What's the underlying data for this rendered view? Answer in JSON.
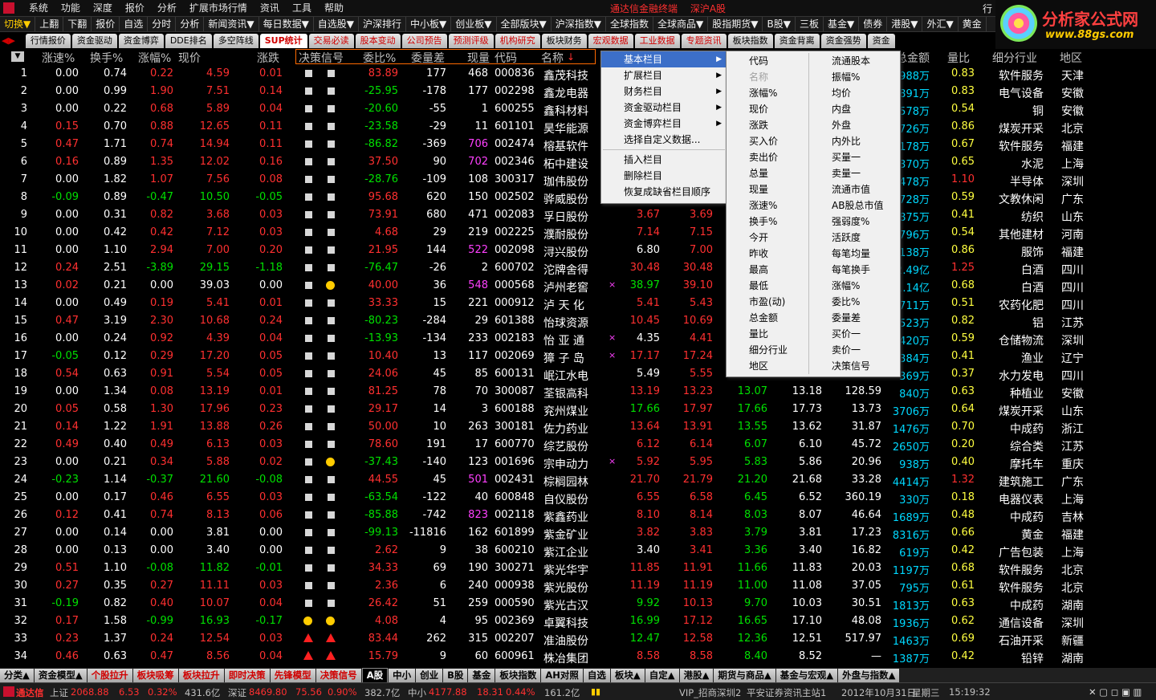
{
  "menubar": {
    "items": [
      "系统",
      "功能",
      "深度",
      "报价",
      "分析",
      "扩展市场行情",
      "资讯",
      "工具",
      "帮助"
    ],
    "center": [
      "通达信金融终端",
      "深沪A股"
    ],
    "right_stub": "行"
  },
  "toolbar": [
    "切换▼",
    "上翻",
    "下翻",
    "报价",
    "自选",
    "分时",
    "分析",
    "新闻资讯▼",
    "每日数据▼",
    "自选股▼",
    "沪深排行",
    "中小板▼",
    "创业板▼",
    "全部版块▼",
    "沪深指数▼",
    "全球指数",
    "全球商品▼",
    "股指期货▼",
    "B股▼",
    "三板",
    "基金▼",
    "债券",
    "港股▼",
    "外汇▼",
    "黄金"
  ],
  "brand": {
    "name": "分析家公式网",
    "url": "www.88gs.com"
  },
  "tabs": [
    {
      "label": "行情报价",
      "style": "normal"
    },
    {
      "label": "资金驱动",
      "style": "normal"
    },
    {
      "label": "资金博弈",
      "style": "normal"
    },
    {
      "label": "DDE排名",
      "style": "normal"
    },
    {
      "label": "多空阵线",
      "style": "normal"
    },
    {
      "label": "SUP统计",
      "style": "active"
    },
    {
      "label": "交易必读",
      "style": "red"
    },
    {
      "label": "股本变动",
      "style": "red"
    },
    {
      "label": "公司预告",
      "style": "red"
    },
    {
      "label": "预测评级",
      "style": "red"
    },
    {
      "label": "机构研究",
      "style": "red"
    },
    {
      "label": "板块财务",
      "style": "normal"
    },
    {
      "label": "宏观数据",
      "style": "red"
    },
    {
      "label": "工业数据",
      "style": "red"
    },
    {
      "label": "专题资讯",
      "style": "red"
    },
    {
      "label": "板块指数",
      "style": "normal"
    },
    {
      "label": "资金背离",
      "style": "normal"
    },
    {
      "label": "资金强势",
      "style": "normal"
    },
    {
      "label": "资金",
      "style": "normal"
    }
  ],
  "columns": [
    "涨速%",
    "换手%",
    "涨幅%",
    "现价",
    "涨跌",
    "决策信号",
    "委比%",
    "委量差",
    "现量",
    "代码",
    "名称",
    "总金额",
    "量比",
    "细分行业",
    "地区"
  ],
  "sort_icon": "▼",
  "rows": [
    {
      "n": "1",
      "spd": "0.00",
      "hs": "0.74",
      "zf": "0.22",
      "xj": "4.59",
      "zd": "0.01",
      "sig": "sq",
      "wb": "83.89",
      "wlc": "177",
      "xl": "468",
      "code": "000836",
      "name": "鑫茂科技",
      "p1": "",
      "p2": "",
      "p3": "",
      "p4": "",
      "p5": "",
      "amt": "988万",
      "lb": "0.83",
      "ind": "软件服务",
      "area": "天津"
    },
    {
      "n": "2",
      "spd": "0.00",
      "hs": "0.99",
      "zf": "1.90",
      "xj": "7.51",
      "zd": "0.14",
      "sig": "sq",
      "wb": "-25.95",
      "wlc": "-178",
      "xl": "177",
      "code": "002298",
      "name": "鑫龙电器",
      "p1": "",
      "p2": "",
      "p3": "",
      "p4": "",
      "p5": "",
      "amt": "891万",
      "lb": "0.83",
      "ind": "电气设备",
      "area": "安徽"
    },
    {
      "n": "3",
      "spd": "0.00",
      "hs": "0.22",
      "zf": "0.68",
      "xj": "5.89",
      "zd": "0.04",
      "sig": "sq",
      "wb": "-20.60",
      "wlc": "-55",
      "xl": "1",
      "code": "600255",
      "name": "鑫科材料",
      "p1": "",
      "p2": "",
      "p3": "",
      "p4": "",
      "p5": "",
      "amt": "578万",
      "lb": "0.54",
      "ind": "铜",
      "area": "安徽"
    },
    {
      "n": "4",
      "spd": "0.15",
      "hs": "0.70",
      "zf": "0.88",
      "xj": "12.65",
      "zd": "0.11",
      "sig": "sq",
      "wb": "-23.58",
      "wlc": "-29",
      "xl": "11",
      "code": "601101",
      "name": "昊华能源",
      "p1": "",
      "p2": "",
      "p3": "",
      "p4": "",
      "p5": "",
      "amt": "726万",
      "lb": "0.86",
      "ind": "煤炭开采",
      "area": "北京"
    },
    {
      "n": "5",
      "spd": "0.47",
      "hs": "1.71",
      "zf": "0.74",
      "xj": "14.94",
      "zd": "0.11",
      "sig": "sq",
      "wb": "-86.82",
      "wlc": "-369",
      "xl": "706",
      "code": "002474",
      "name": "榕基软件",
      "p1": "",
      "p2": "",
      "p3": "",
      "p4": "",
      "p5": "",
      "amt": "178万",
      "lb": "0.67",
      "ind": "软件服务",
      "area": "福建"
    },
    {
      "n": "6",
      "spd": "0.16",
      "hs": "0.89",
      "zf": "1.35",
      "xj": "12.02",
      "zd": "0.16",
      "sig": "sq",
      "wb": "37.50",
      "wlc": "90",
      "xl": "702",
      "code": "002346",
      "name": "柘中建设",
      "p1": "",
      "p2": "",
      "p3": "",
      "p4": "",
      "p5": "",
      "amt": "370万",
      "lb": "0.65",
      "ind": "水泥",
      "area": "上海"
    },
    {
      "n": "7",
      "spd": "0.00",
      "hs": "1.82",
      "zf": "1.07",
      "xj": "7.56",
      "zd": "0.08",
      "sig": "sq",
      "wb": "-28.76",
      "wlc": "-109",
      "xl": "108",
      "code": "300317",
      "name": "珈伟股份",
      "p1": "",
      "p2": "",
      "p3": "",
      "p4": "",
      "p5": "",
      "amt": "478万",
      "lb": "1.10",
      "ind": "半导体",
      "area": "深圳"
    },
    {
      "n": "8",
      "spd": "-0.09",
      "hs": "0.89",
      "zf": "-0.47",
      "xj": "10.50",
      "zd": "-0.05",
      "sig": "sq",
      "wb": "95.68",
      "wlc": "620",
      "xl": "150",
      "code": "002502",
      "name": "骅威股份",
      "p1": "",
      "p2": "",
      "p3": "",
      "p4": "",
      "p5": "",
      "amt": "728万",
      "lb": "0.59",
      "ind": "文教休闲",
      "area": "广东"
    },
    {
      "n": "9",
      "spd": "0.00",
      "hs": "0.31",
      "zf": "0.82",
      "xj": "3.68",
      "zd": "0.03",
      "sig": "sq",
      "wb": "73.91",
      "wlc": "680",
      "xl": "471",
      "code": "002083",
      "name": "孚日股份",
      "p1": "3.67",
      "p2": "3.69",
      "p3": "",
      "p4": "",
      "p5": "",
      "amt": "875万",
      "lb": "0.41",
      "ind": "纺织",
      "area": "山东"
    },
    {
      "n": "10",
      "spd": "0.00",
      "hs": "0.42",
      "zf": "0.42",
      "xj": "7.12",
      "zd": "0.03",
      "sig": "sq",
      "wb": "4.68",
      "wlc": "29",
      "xl": "219",
      "code": "002225",
      "name": "濮耐股份",
      "p1": "7.14",
      "p2": "7.15",
      "p3": "",
      "p4": "",
      "p5": "",
      "amt": "796万",
      "lb": "0.54",
      "ind": "其他建材",
      "area": "河南"
    },
    {
      "n": "11",
      "spd": "0.00",
      "hs": "1.10",
      "zf": "2.94",
      "xj": "7.00",
      "zd": "0.20",
      "sig": "sq",
      "wb": "21.95",
      "wlc": "144",
      "xl": "522",
      "code": "002098",
      "name": "浔兴股份",
      "p1": "6.80",
      "p2": "7.00",
      "p3": "",
      "p4": "",
      "p5": "",
      "amt": "138万",
      "lb": "0.86",
      "ind": "服饰",
      "area": "福建"
    },
    {
      "n": "12",
      "spd": "0.24",
      "hs": "2.51",
      "zf": "-3.89",
      "xj": "29.15",
      "zd": "-1.18",
      "sig": "sq",
      "wb": "-76.47",
      "wlc": "-26",
      "xl": "2",
      "code": "600702",
      "name": "沱牌舍得",
      "p1": "30.48",
      "p2": "30.48",
      "p3": "",
      "p4": "",
      "p5": "",
      "amt": "2.49亿",
      "lb": "1.25",
      "ind": "白酒",
      "area": "四川"
    },
    {
      "n": "13",
      "spd": "0.02",
      "hs": "0.21",
      "zf": "0.00",
      "xj": "39.03",
      "zd": "0.00",
      "sig": "sqdot",
      "wb": "40.00",
      "wlc": "36",
      "xl": "548",
      "code": "000568",
      "name": "泸州老窖",
      "p1": "38.97",
      "p2": "39.10",
      "p3": "",
      "p4": "",
      "p5": "",
      "amt": "1.14亿",
      "lb": "0.68",
      "ind": "白酒",
      "area": "四川",
      "mark": "×"
    },
    {
      "n": "14",
      "spd": "0.00",
      "hs": "0.49",
      "zf": "0.19",
      "xj": "5.41",
      "zd": "0.01",
      "sig": "sq",
      "wb": "33.33",
      "wlc": "15",
      "xl": "221",
      "code": "000912",
      "name": "泸 天 化",
      "p1": "5.41",
      "p2": "5.43",
      "p3": "",
      "p4": "",
      "p5": "",
      "amt": "711万",
      "lb": "0.51",
      "ind": "农药化肥",
      "area": "四川"
    },
    {
      "n": "15",
      "spd": "0.47",
      "hs": "3.19",
      "zf": "2.30",
      "xj": "10.68",
      "zd": "0.24",
      "sig": "sq",
      "wb": "-80.23",
      "wlc": "-284",
      "xl": "29",
      "code": "601388",
      "name": "怡球资源",
      "p1": "10.45",
      "p2": "10.69",
      "p3": "",
      "p4": "",
      "p5": "",
      "amt": "523万",
      "lb": "0.82",
      "ind": "铝",
      "area": "江苏"
    },
    {
      "n": "16",
      "spd": "0.00",
      "hs": "0.24",
      "zf": "0.92",
      "xj": "4.39",
      "zd": "0.04",
      "sig": "sq",
      "wb": "-13.93",
      "wlc": "-134",
      "xl": "233",
      "code": "002183",
      "name": "怡 亚 通",
      "p1": "4.35",
      "p2": "4.41",
      "p3": "",
      "p4": "",
      "p5": "",
      "amt": "420万",
      "lb": "0.59",
      "ind": "仓储物流",
      "area": "深圳",
      "mark": "×"
    },
    {
      "n": "17",
      "spd": "-0.05",
      "hs": "0.12",
      "zf": "0.29",
      "xj": "17.20",
      "zd": "0.05",
      "sig": "sq",
      "wb": "10.40",
      "wlc": "13",
      "xl": "117",
      "code": "002069",
      "name": "獐 子 岛",
      "p1": "17.17",
      "p2": "17.24",
      "p3": "",
      "p4": "",
      "p5": "",
      "amt": "384万",
      "lb": "0.41",
      "ind": "渔业",
      "area": "辽宁",
      "mark": "×"
    },
    {
      "n": "18",
      "spd": "0.54",
      "hs": "0.63",
      "zf": "0.91",
      "xj": "5.54",
      "zd": "0.05",
      "sig": "sq",
      "wb": "24.06",
      "wlc": "45",
      "xl": "85",
      "code": "600131",
      "name": "岷江水电",
      "p1": "5.49",
      "p2": "5.55",
      "p3": "",
      "p4": "",
      "p5": "",
      "amt": "369万",
      "lb": "0.37",
      "ind": "水力发电",
      "area": "四川"
    },
    {
      "n": "19",
      "spd": "0.00",
      "hs": "1.34",
      "zf": "0.08",
      "xj": "13.19",
      "zd": "0.01",
      "sig": "sq",
      "wb": "81.25",
      "wlc": "78",
      "xl": "70",
      "code": "300087",
      "name": "荃银高科",
      "p1": "13.19",
      "p2": "13.23",
      "p3": "13.07",
      "p4": "13.18",
      "p5": "128.59",
      "amt": "840万",
      "lb": "0.63",
      "ind": "种植业",
      "area": "安徽"
    },
    {
      "n": "20",
      "spd": "0.05",
      "hs": "0.58",
      "zf": "1.30",
      "xj": "17.96",
      "zd": "0.23",
      "sig": "sq",
      "wb": "29.17",
      "wlc": "14",
      "xl": "3",
      "code": "600188",
      "name": "兖州煤业",
      "p1": "17.66",
      "p2": "17.97",
      "p3": "17.66",
      "p4": "17.73",
      "p5": "13.73",
      "amt": "3706万",
      "lb": "0.64",
      "ind": "煤炭开采",
      "area": "山东"
    },
    {
      "n": "21",
      "spd": "0.14",
      "hs": "1.22",
      "zf": "1.91",
      "xj": "13.88",
      "zd": "0.26",
      "sig": "sq",
      "wb": "50.00",
      "wlc": "10",
      "xl": "263",
      "code": "300181",
      "name": "佐力药业",
      "p1": "13.64",
      "p2": "13.91",
      "p3": "13.55",
      "p4": "13.62",
      "p5": "31.87",
      "amt": "1476万",
      "lb": "0.70",
      "ind": "中成药",
      "area": "浙江"
    },
    {
      "n": "22",
      "spd": "0.49",
      "hs": "0.40",
      "zf": "0.49",
      "xj": "6.13",
      "zd": "0.03",
      "sig": "sq",
      "wb": "78.60",
      "wlc": "191",
      "xl": "17",
      "code": "600770",
      "name": "综艺股份",
      "p1": "6.12",
      "p2": "6.14",
      "p3": "6.07",
      "p4": "6.10",
      "p5": "45.72",
      "amt": "2650万",
      "lb": "0.20",
      "ind": "综合类",
      "area": "江苏"
    },
    {
      "n": "23",
      "spd": "0.00",
      "hs": "0.21",
      "zf": "0.34",
      "xj": "5.88",
      "zd": "0.02",
      "sig": "sqdot",
      "wb": "-37.43",
      "wlc": "-140",
      "xl": "123",
      "code": "001696",
      "name": "宗申动力",
      "p1": "5.92",
      "p2": "5.95",
      "p3": "5.83",
      "p4": "5.86",
      "p5": "20.96",
      "amt": "938万",
      "lb": "0.40",
      "ind": "摩托车",
      "area": "重庆",
      "mark": "×"
    },
    {
      "n": "24",
      "spd": "-0.23",
      "hs": "1.14",
      "zf": "-0.37",
      "xj": "21.60",
      "zd": "-0.08",
      "sig": "sq",
      "wb": "44.55",
      "wlc": "45",
      "xl": "501",
      "code": "002431",
      "name": "棕榈园林",
      "p1": "21.70",
      "p2": "21.79",
      "p3": "21.20",
      "p4": "21.68",
      "p5": "33.28",
      "amt": "4414万",
      "lb": "1.32",
      "ind": "建筑施工",
      "area": "广东"
    },
    {
      "n": "25",
      "spd": "0.00",
      "hs": "0.17",
      "zf": "0.46",
      "xj": "6.55",
      "zd": "0.03",
      "sig": "sq",
      "wb": "-63.54",
      "wlc": "-122",
      "xl": "40",
      "code": "600848",
      "name": "自仪股份",
      "p1": "6.55",
      "p2": "6.58",
      "p3": "6.45",
      "p4": "6.52",
      "p5": "360.19",
      "amt": "330万",
      "lb": "0.18",
      "ind": "电器仪表",
      "area": "上海"
    },
    {
      "n": "26",
      "spd": "0.12",
      "hs": "0.41",
      "zf": "0.74",
      "xj": "8.13",
      "zd": "0.06",
      "sig": "sq",
      "wb": "-85.88",
      "wlc": "-742",
      "xl": "823",
      "code": "002118",
      "name": "紫鑫药业",
      "p1": "8.10",
      "p2": "8.14",
      "p3": "8.03",
      "p4": "8.07",
      "p5": "46.64",
      "amt": "1689万",
      "lb": "0.48",
      "ind": "中成药",
      "area": "吉林"
    },
    {
      "n": "27",
      "spd": "0.00",
      "hs": "0.14",
      "zf": "0.00",
      "xj": "3.81",
      "zd": "0.00",
      "sig": "sq",
      "wb": "-99.13",
      "wlc": "-11816",
      "xl": "162",
      "code": "601899",
      "name": "紫金矿业",
      "p1": "3.82",
      "p2": "3.83",
      "p3": "3.79",
      "p4": "3.81",
      "p5": "17.23",
      "amt": "8316万",
      "lb": "0.66",
      "ind": "黄金",
      "area": "福建"
    },
    {
      "n": "28",
      "spd": "0.00",
      "hs": "0.13",
      "zf": "0.00",
      "xj": "3.40",
      "zd": "0.00",
      "sig": "sq",
      "wb": "2.62",
      "wlc": "9",
      "xl": "38",
      "code": "600210",
      "name": "紫江企业",
      "p1": "3.40",
      "p2": "3.41",
      "p3": "3.36",
      "p4": "3.40",
      "p5": "16.82",
      "amt": "619万",
      "lb": "0.42",
      "ind": "广告包装",
      "area": "上海"
    },
    {
      "n": "29",
      "spd": "0.51",
      "hs": "1.10",
      "zf": "-0.08",
      "xj": "11.82",
      "zd": "-0.01",
      "sig": "sq",
      "wb": "34.33",
      "wlc": "69",
      "xl": "190",
      "code": "300271",
      "name": "紫光华宇",
      "p1": "11.85",
      "p2": "11.91",
      "p3": "11.66",
      "p4": "11.83",
      "p5": "20.03",
      "amt": "1197万",
      "lb": "0.68",
      "ind": "软件服务",
      "area": "北京"
    },
    {
      "n": "30",
      "spd": "0.27",
      "hs": "0.35",
      "zf": "0.27",
      "xj": "11.11",
      "zd": "0.03",
      "sig": "sq",
      "wb": "2.36",
      "wlc": "6",
      "xl": "240",
      "code": "000938",
      "name": "紫光股份",
      "p1": "11.19",
      "p2": "11.19",
      "p3": "11.00",
      "p4": "11.08",
      "p5": "37.05",
      "amt": "795万",
      "lb": "0.61",
      "ind": "软件服务",
      "area": "北京"
    },
    {
      "n": "31",
      "spd": "-0.19",
      "hs": "0.82",
      "zf": "0.40",
      "xj": "10.07",
      "zd": "0.04",
      "sig": "sq",
      "wb": "26.42",
      "wlc": "51",
      "xl": "259",
      "code": "000590",
      "name": "紫光古汉",
      "p1": "9.92",
      "p2": "10.13",
      "p3": "9.70",
      "p4": "10.03",
      "p5": "30.51",
      "amt": "1813万",
      "lb": "0.63",
      "ind": "中成药",
      "area": "湖南"
    },
    {
      "n": "32",
      "spd": "0.17",
      "hs": "1.58",
      "zf": "-0.99",
      "xj": "16.93",
      "zd": "-0.17",
      "sig": "dot",
      "wb": "4.08",
      "wlc": "4",
      "xl": "95",
      "code": "002369",
      "name": "卓翼科技",
      "p1": "16.99",
      "p2": "17.12",
      "p3": "16.65",
      "p4": "17.10",
      "p5": "48.08",
      "amt": "1936万",
      "lb": "0.62",
      "ind": "通信设备",
      "area": "深圳"
    },
    {
      "n": "33",
      "spd": "0.23",
      "hs": "1.37",
      "zf": "0.24",
      "xj": "12.54",
      "zd": "0.03",
      "sig": "tri",
      "wb": "83.44",
      "wlc": "262",
      "xl": "315",
      "code": "002207",
      "name": "准油股份",
      "p1": "12.47",
      "p2": "12.58",
      "p3": "12.36",
      "p4": "12.51",
      "p5": "517.97",
      "amt": "1463万",
      "lb": "0.69",
      "ind": "石油开采",
      "area": "新疆"
    },
    {
      "n": "34",
      "spd": "0.46",
      "hs": "0.63",
      "zf": "0.47",
      "xj": "8.56",
      "zd": "0.04",
      "sig": "tri",
      "wb": "15.79",
      "wlc": "9",
      "xl": "60",
      "code": "600961",
      "name": "株冶集团",
      "p1": "8.58",
      "p2": "8.58",
      "p3": "8.40",
      "p4": "8.52",
      "p5": "—",
      "amt": "1387万",
      "lb": "0.42",
      "ind": "铅锌",
      "area": "湖南"
    }
  ],
  "ctxmenu": {
    "items": [
      {
        "label": "基本栏目",
        "arrow": "▶",
        "hl": true
      },
      {
        "label": "扩展栏目",
        "arrow": "▶"
      },
      {
        "label": "财务栏目",
        "arrow": "▶"
      },
      {
        "label": "资金驱动栏目",
        "arrow": "▶"
      },
      {
        "label": "资金博弈栏目",
        "arrow": "▶"
      },
      {
        "label": "选择自定义数据...",
        "arrow": ""
      }
    ],
    "items2": [
      {
        "label": "插入栏目"
      },
      {
        "label": "删除栏目"
      },
      {
        "label": "恢复成缺省栏目顺序"
      }
    ]
  },
  "submenu": {
    "col1": [
      "代码",
      "名称",
      "涨幅%",
      "现价",
      "涨跌",
      "买入价",
      "卖出价",
      "总量",
      "现量",
      "涨速%",
      "换手%",
      "今开",
      "昨收",
      "最高",
      "最低",
      "市盈(动)",
      "总金额",
      "量比",
      "细分行业",
      "地区"
    ],
    "col1_disabled": [
      1
    ],
    "col2": [
      "流通股本",
      "振幅%",
      "均价",
      "内盘",
      "外盘",
      "内外比",
      "买量一",
      "卖量一",
      "流通市值",
      "AB股总市值",
      "强弱度%",
      "活跃度",
      "每笔均量",
      "每笔换手",
      "涨幅%",
      "委比%",
      "委量差",
      "买价一",
      "卖价一",
      "决策信号"
    ]
  },
  "bottom_tabs": [
    {
      "label": "分类▲",
      "style": "normal"
    },
    {
      "label": "资金模型▲",
      "style": "normal"
    },
    {
      "label": "个股拉升",
      "style": "red"
    },
    {
      "label": "板块吸筹",
      "style": "red"
    },
    {
      "label": "板块拉升",
      "style": "red"
    },
    {
      "label": "即时决策",
      "style": "red"
    },
    {
      "label": "先锋模型",
      "style": "red"
    },
    {
      "label": "决策信号",
      "style": "red"
    },
    {
      "label": "A股",
      "style": "sel"
    },
    {
      "label": "中小",
      "style": "normal"
    },
    {
      "label": "创业",
      "style": "normal"
    },
    {
      "label": "B股",
      "style": "normal"
    },
    {
      "label": "基金",
      "style": "normal"
    },
    {
      "label": "板块指数",
      "style": "normal"
    },
    {
      "label": "AH对照",
      "style": "normal"
    },
    {
      "label": "自选",
      "style": "normal"
    },
    {
      "label": "板块▲",
      "style": "normal"
    },
    {
      "label": "自定▲",
      "style": "normal"
    },
    {
      "label": "港股▲",
      "style": "normal"
    },
    {
      "label": "期货与商品▲",
      "style": "normal"
    },
    {
      "label": "基金与宏观▲",
      "style": "normal"
    },
    {
      "label": "外盘与指数▲",
      "style": "normal"
    }
  ],
  "status": {
    "brand": "通达信",
    "sh_label": "上证",
    "sh_val": "2068.88",
    "sh_chg": "6.53",
    "sh_pct": "0.32%",
    "sh_amt": "431.6亿",
    "sz_label": "深证",
    "sz_val": "8469.80",
    "sz_chg": "75.56",
    "sz_pct": "0.90%",
    "sz_amt": "382.7亿",
    "zx_label": "中小",
    "zx_val": "4177.88",
    "zx_chg": "18.31",
    "zx_pct": "0.44%",
    "zx_amt": "161.2亿",
    "server": "VIP_招商深圳2",
    "info": "平安证券资讯主站1",
    "date": "2012年10月31日",
    "weekday": "星期三",
    "time": "15:19:32"
  },
  "colors": {
    "up": "#ff3030",
    "down": "#00e000",
    "accent": "#ffcc00",
    "menu_highlight": "#3c6fc8"
  }
}
